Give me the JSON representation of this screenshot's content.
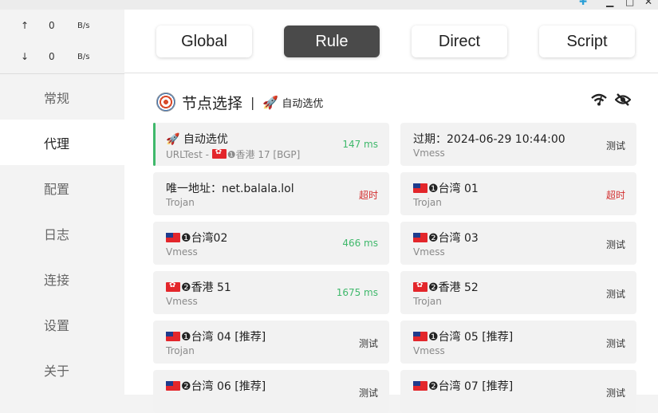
{
  "speed": {
    "upload": {
      "arrow": "↑",
      "value": "0",
      "unit": "B/s"
    },
    "download": {
      "arrow": "↓",
      "value": "0",
      "unit": "B/s"
    }
  },
  "nav": [
    {
      "label": "常规",
      "active": false
    },
    {
      "label": "代理",
      "active": true
    },
    {
      "label": "配置",
      "active": false
    },
    {
      "label": "日志",
      "active": false
    },
    {
      "label": "连接",
      "active": false
    },
    {
      "label": "设置",
      "active": false
    },
    {
      "label": "关于",
      "active": false
    }
  ],
  "modes": [
    {
      "label": "Global",
      "active": false
    },
    {
      "label": "Rule",
      "active": true
    },
    {
      "label": "Direct",
      "active": false
    },
    {
      "label": "Script",
      "active": false
    }
  ],
  "group": {
    "title": "节点选择",
    "separator": "|",
    "now_icon": "🚀",
    "now": "自动选优",
    "icons": [
      "wifi-icon",
      "eye-off-icon"
    ]
  },
  "proxies": [
    {
      "name_prefix": "🚀",
      "name": "自动选优",
      "type_prefix": "URLTest - ",
      "type_flag": "hk",
      "type_num": "❶",
      "type": "香港 17 [BGP]",
      "latency": "147 ms",
      "status": "ok",
      "selected": true
    },
    {
      "name": "过期：2024-06-29 10:44:00",
      "type": "Vmess",
      "latency": "测试",
      "status": "test"
    },
    {
      "name": "唯一地址：net.balala.lol",
      "type": "Trojan",
      "latency": "超时",
      "status": "bad"
    },
    {
      "flag": "tw",
      "num": "❶",
      "name": "台湾 01",
      "type": "Trojan",
      "latency": "超时",
      "status": "bad"
    },
    {
      "flag": "tw",
      "num": "❶",
      "name": "台湾02",
      "type": "Vmess",
      "latency": "466 ms",
      "status": "ok"
    },
    {
      "flag": "tw",
      "num": "❷",
      "name": "台湾 03",
      "type": "Vmess",
      "latency": "测试",
      "status": "test"
    },
    {
      "flag": "hk",
      "num": "❷",
      "name": "香港 51",
      "type": "Vmess",
      "latency": "1675 ms",
      "status": "ok"
    },
    {
      "flag": "hk",
      "num": "❷",
      "name": "香港 52",
      "type": "Trojan",
      "latency": "测试",
      "status": "test"
    },
    {
      "flag": "tw",
      "num": "❶",
      "name": "台湾 04 [推荐]",
      "type": "Trojan",
      "latency": "测试",
      "status": "test"
    },
    {
      "flag": "tw",
      "num": "❶",
      "name": "台湾 05 [推荐]",
      "type": "Vmess",
      "latency": "测试",
      "status": "test"
    },
    {
      "flag": "tw",
      "num": "❷",
      "name": "台湾 06 [推荐]",
      "type": "",
      "latency": "测试",
      "status": "test"
    },
    {
      "flag": "tw",
      "num": "❷",
      "name": "台湾 07 [推荐]",
      "type": "",
      "latency": "测试",
      "status": "test"
    }
  ]
}
